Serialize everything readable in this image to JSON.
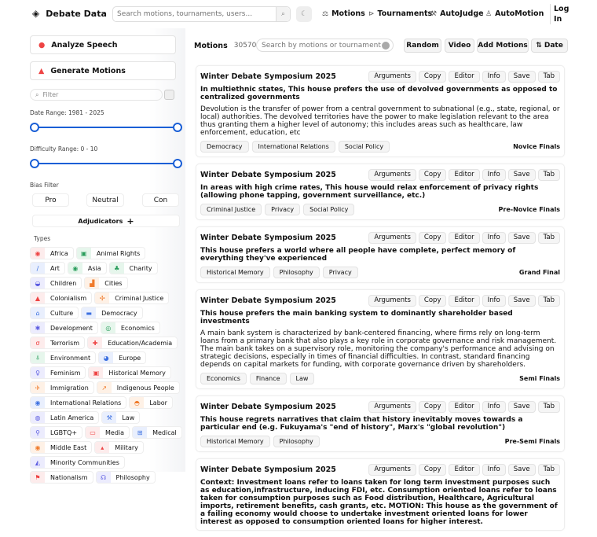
{
  "header": {
    "brand": "Debate Data",
    "search_placeholder": "Search motions, tournaments, users...",
    "nav": [
      {
        "label": "Motions",
        "icon": "⚖"
      },
      {
        "label": "Tournaments",
        "icon": "⊳"
      },
      {
        "label": "AutoJudge",
        "icon": "⚒"
      },
      {
        "label": "AutoMotion",
        "icon": "♙"
      }
    ],
    "login": "Log In"
  },
  "sidebar": {
    "analyze": "Analyze Speech",
    "generate": "Generate Motions",
    "filter_placeholder": "Filter",
    "date_label": "Date Range: 1981 - 2025",
    "date_range": [
      1981,
      2025
    ],
    "difficulty_label": "Difficulty Range: 0 - 10",
    "difficulty_range": [
      0,
      10
    ],
    "bias_label": "Bias Filter",
    "bias": [
      "Pro",
      "Neutral",
      "Con"
    ],
    "adjudicators": "Adjudicators",
    "types_label": "Types",
    "types": [
      {
        "label": "Africa",
        "color": "#e44",
        "bg": "#fdecec",
        "icon": "◉"
      },
      {
        "label": "Animal Rights",
        "color": "#2a9d5c",
        "bg": "#e6f6ec",
        "icon": "▣"
      },
      {
        "label": "Art",
        "color": "#3b6fe0",
        "bg": "#e9effd",
        "icon": "∕"
      },
      {
        "label": "Asia",
        "color": "#2a9d5c",
        "bg": "#e6f6ec",
        "icon": "◉"
      },
      {
        "label": "Charity",
        "color": "#2a9d5c",
        "bg": "#e6f6ec",
        "icon": "♣"
      },
      {
        "label": "Children",
        "color": "#5a5ae0",
        "bg": "#ececfd",
        "icon": "◒"
      },
      {
        "label": "Cities",
        "color": "#f07a2a",
        "bg": "#fef1e6",
        "icon": "▟"
      },
      {
        "label": "Colonialism",
        "color": "#e44",
        "bg": "#fdecec",
        "icon": "▲"
      },
      {
        "label": "Criminal Justice",
        "color": "#f07a2a",
        "bg": "#fef1e6",
        "icon": "✣"
      },
      {
        "label": "Culture",
        "color": "#3b6fe0",
        "bg": "#e9effd",
        "icon": "⌂"
      },
      {
        "label": "Democracy",
        "color": "#3b6fe0",
        "bg": "#e9effd",
        "icon": "▬"
      },
      {
        "label": "Development",
        "color": "#5a5ae0",
        "bg": "#ececfd",
        "icon": "✱"
      },
      {
        "label": "Economics",
        "color": "#2a9d5c",
        "bg": "#e6f6ec",
        "icon": "◎"
      },
      {
        "label": "Terrorism",
        "color": "#e44",
        "bg": "#fdecec",
        "icon": "σ"
      },
      {
        "label": "Education/Academia",
        "color": "#e44",
        "bg": "#fdecec",
        "icon": "✚"
      },
      {
        "label": "Environment",
        "color": "#2a9d5c",
        "bg": "#e6f6ec",
        "icon": "⍋"
      },
      {
        "label": "Europe",
        "color": "#3b6fe0",
        "bg": "#e9effd",
        "icon": "◕"
      },
      {
        "label": "Feminism",
        "color": "#5a5ae0",
        "bg": "#ececfd",
        "icon": "♀"
      },
      {
        "label": "Historical Memory",
        "color": "#e44",
        "bg": "#fdecec",
        "icon": "▣"
      },
      {
        "label": "Immigration",
        "color": "#f07a2a",
        "bg": "#fef1e6",
        "icon": "✈"
      },
      {
        "label": "Indigenous People",
        "color": "#f07a2a",
        "bg": "#fef1e6",
        "icon": "↗"
      },
      {
        "label": "International Relations",
        "color": "#3b6fe0",
        "bg": "#e9effd",
        "icon": "◉"
      },
      {
        "label": "Labor",
        "color": "#f07a2a",
        "bg": "#fef1e6",
        "icon": "◓"
      },
      {
        "label": "Latin America",
        "color": "#5a5ae0",
        "bg": "#ececfd",
        "icon": "◍"
      },
      {
        "label": "Law",
        "color": "#3b6fe0",
        "bg": "#e9effd",
        "icon": "⚒"
      },
      {
        "label": "LGBTQ+",
        "color": "#5a5ae0",
        "bg": "#ececfd",
        "icon": "⚲"
      },
      {
        "label": "Media",
        "color": "#e44",
        "bg": "#fdecec",
        "icon": "▭"
      },
      {
        "label": "Medical",
        "color": "#3b6fe0",
        "bg": "#e9effd",
        "icon": "⊞"
      },
      {
        "label": "Middle East",
        "color": "#f07a2a",
        "bg": "#fef1e6",
        "icon": "◉"
      },
      {
        "label": "Military",
        "color": "#e44",
        "bg": "#fdecec",
        "icon": "▴"
      },
      {
        "label": "Minority Communities",
        "color": "#5a5ae0",
        "bg": "#ececfd",
        "icon": "◭"
      },
      {
        "label": "Nationalism",
        "color": "#e44",
        "bg": "#fdecec",
        "icon": "⚑"
      },
      {
        "label": "Philosophy",
        "color": "#5a5ae0",
        "bg": "#ececfd",
        "icon": "☊"
      }
    ]
  },
  "main": {
    "title": "Motions",
    "count": "30570",
    "search_placeholder": "Search by motions or tournament",
    "buttons": {
      "random": "Random",
      "video": "Video",
      "add": "Add Motions",
      "sort": "⇅ Date"
    },
    "actions": [
      "Arguments",
      "Copy",
      "Editor",
      "Info",
      "Save",
      "Tab"
    ],
    "motions": [
      {
        "tournament": "Winter Debate Symposium 2025",
        "motion": "In multiethnic states, This house prefers the use of devolved governments as opposed to centralized governments",
        "info": "Devolution is the transfer of power from a central government to subnational (e.g., state, regional, or local) authorities. The devolved territories have the power to make legislation relevant to the area thus granting them a higher level of autonomy; this includes areas such as healthcare, law enforcement, education, etc",
        "tags": [
          "Democracy",
          "International Relations",
          "Social Policy"
        ],
        "round": "Novice Finals"
      },
      {
        "tournament": "Winter Debate Symposium 2025",
        "motion": "In areas with high crime rates, This house would relax enforcement of privacy rights (allowing phone tapping, government surveillance, etc.)",
        "info": "",
        "tags": [
          "Criminal Justice",
          "Privacy",
          "Social Policy"
        ],
        "round": "Pre-Novice Finals"
      },
      {
        "tournament": "Winter Debate Symposium 2025",
        "motion": "This house prefers a world where all people have complete, perfect memory of everything they've experienced",
        "info": "",
        "tags": [
          "Historical Memory",
          "Philosophy",
          "Privacy"
        ],
        "round": "Grand Final"
      },
      {
        "tournament": "Winter Debate Symposium 2025",
        "motion": "This house prefers the main banking system to dominantly shareholder based investments",
        "info": "A main bank system is characterized by bank-centered financing, where firms rely on long-term loans from a primary bank that also plays a key role in corporate governance and risk management. The main bank takes on a supervisory role, monitoring the company's performance and advising on strategic decisions, especially in times of financial difficulties. In contrast, standard financing depends on capital markets for funding, with corporate governance driven by shareholders.",
        "tags": [
          "Economics",
          "Finance",
          "Law"
        ],
        "round": "Semi Finals"
      },
      {
        "tournament": "Winter Debate Symposium 2025",
        "motion": "This house regrets narratives that claim that history inevitably moves towards a particular end (e.g. Fukuyama's \"end of history\", Marx's \"global revolution\")",
        "info": "",
        "tags": [
          "Historical Memory",
          "Philosophy"
        ],
        "round": "Pre-Semi Finals"
      },
      {
        "tournament": "Winter Debate Symposium 2025",
        "motion": "Context: Investment loans refer to loans taken for long term investment purposes such as education,infrastructure, inducing FDI, etc. Consumption oriented loans refer to loans taken for consumption purposes such as Food distribution, Healthcare, Agricultural imports, retirement benefits, cash grants, etc. MOTION: This house as the government of a failing economy would choose to undertake investment oriented loans for lower interest as opposed to consumption oriented loans for higher interest.",
        "info": "",
        "tags": [],
        "round": ""
      }
    ]
  }
}
